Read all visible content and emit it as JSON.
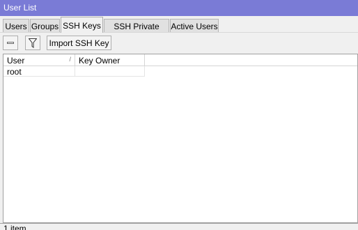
{
  "window": {
    "title": "User List"
  },
  "tabs": [
    {
      "label": "Users",
      "active": false
    },
    {
      "label": "Groups",
      "active": false
    },
    {
      "label": "SSH Keys",
      "active": true
    },
    {
      "label": "SSH Private Keys",
      "active": false
    },
    {
      "label": "Active Users",
      "active": false
    }
  ],
  "toolbar": {
    "remove_icon": "minus-icon",
    "filter_icon": "filter-icon",
    "import_label": "Import SSH Key"
  },
  "table": {
    "columns": [
      "User",
      "Key Owner"
    ],
    "sort_indicator": "/",
    "rows": [
      {
        "user": "root",
        "key_owner": ""
      }
    ]
  },
  "status": {
    "text": "1 item"
  },
  "colors": {
    "titlebar": "#7a7bd6"
  }
}
